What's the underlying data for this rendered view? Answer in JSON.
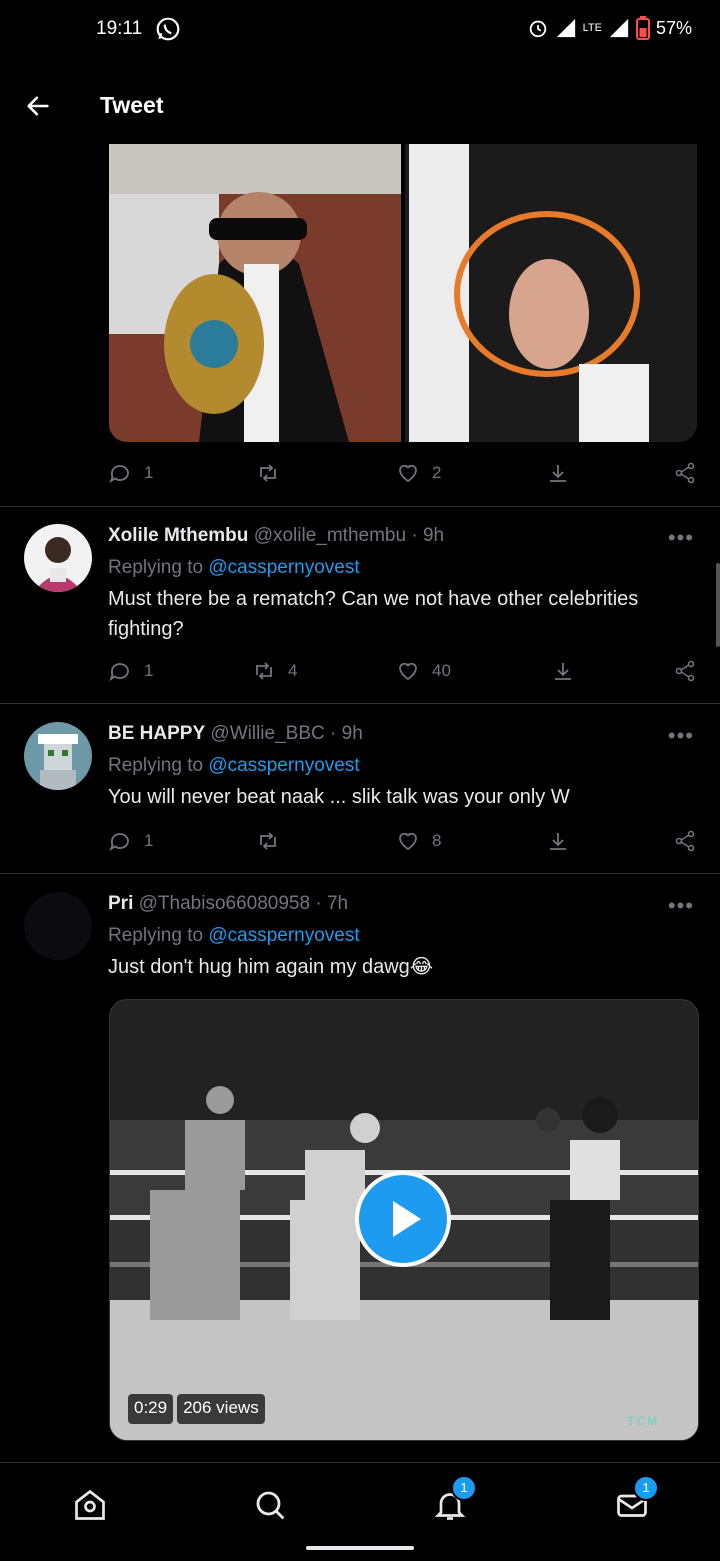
{
  "status_bar": {
    "time": "19:11",
    "network": "LTE",
    "battery": "57%"
  },
  "header": {
    "title": "Tweet"
  },
  "top_tweet": {
    "actions": {
      "replies": "1",
      "retweets": "",
      "likes": "2"
    }
  },
  "tweets": [
    {
      "name": "Xolile Mthembu",
      "handle": "@xolile_mthembu",
      "time": "9h",
      "replying_prefix": "Replying to ",
      "replying_to": "@casspernyovest",
      "text": "Must there be a rematch? Can we not have other celebrities fighting?",
      "replies": "1",
      "retweets": "4",
      "likes": "40"
    },
    {
      "name": "BE HAPPY",
      "handle": "@Willie_BBC",
      "time": "9h",
      "replying_prefix": "Replying to ",
      "replying_to": "@casspernyovest",
      "text": "You will never beat naak ... slik talk was your only W",
      "replies": "1",
      "retweets": "",
      "likes": "8"
    },
    {
      "name": "Pri",
      "handle": "@Thabiso66080958",
      "time": "7h",
      "replying_prefix": "Replying to ",
      "replying_to": "@casspernyovest",
      "text": "Just don't hug him again my dawg😂",
      "video_duration": "0:29",
      "video_views": "206 views",
      "video_watermark": "TCM"
    }
  ],
  "bottom_nav": {
    "notifications_badge": "1",
    "messages_badge": "1"
  },
  "colors": {
    "accent": "#1d9bf0",
    "muted": "#71767b",
    "background": "#000000"
  },
  "icons": [
    "back-arrow-icon",
    "whatsapp-icon",
    "alarm-icon",
    "signal-icon",
    "battery-icon",
    "reply-icon",
    "retweet-icon",
    "like-icon",
    "bookmark-icon",
    "share-icon",
    "more-icon",
    "play-icon",
    "home-icon",
    "search-icon",
    "notifications-icon",
    "messages-icon"
  ]
}
